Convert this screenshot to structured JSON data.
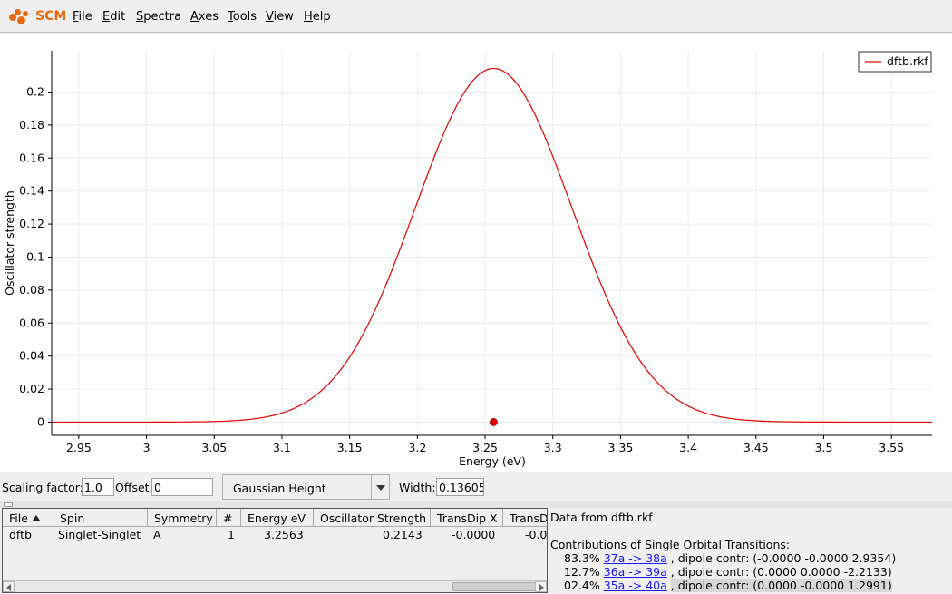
{
  "app": {
    "logo_text": "SCM",
    "menu": [
      "File",
      "Edit",
      "Spectra",
      "Axes",
      "Tools",
      "View",
      "Help"
    ],
    "menu_mnemonics": [
      "F",
      "E",
      "S",
      "A",
      "T",
      "V",
      "H"
    ]
  },
  "chart_data": {
    "type": "line",
    "xlabel": "Energy (eV)",
    "ylabel": "Oscillator strength",
    "xlim": [
      2.93,
      3.58
    ],
    "ylim": [
      -0.008,
      0.225
    ],
    "x_ticks": [
      "2.95",
      "3",
      "3.05",
      "3.1",
      "3.15",
      "3.2",
      "3.25",
      "3.3",
      "3.35",
      "3.4",
      "3.45",
      "3.5",
      "3.55"
    ],
    "x_tick_values": [
      2.95,
      3.0,
      3.05,
      3.1,
      3.15,
      3.2,
      3.25,
      3.3,
      3.35,
      3.4,
      3.45,
      3.5,
      3.55
    ],
    "y_ticks": [
      "0",
      "0.02",
      "0.04",
      "0.06",
      "0.08",
      "0.1",
      "0.12",
      "0.14",
      "0.16",
      "0.18",
      "0.2"
    ],
    "y_tick_values": [
      0,
      0.02,
      0.04,
      0.06,
      0.08,
      0.1,
      0.12,
      0.14,
      0.16,
      0.18,
      0.2
    ],
    "grid": true,
    "legend_position": "top-right",
    "series": [
      {
        "name": "dftb.rkf",
        "color": "#e00000",
        "shape": "gaussian",
        "center": 3.2563,
        "height": 0.2143,
        "width": 0.13605
      }
    ],
    "markers": [
      {
        "x": 3.2563,
        "y": 0,
        "color": "#e00000"
      }
    ]
  },
  "controls": {
    "scaling_label": "Scaling factor:",
    "scaling_value": "1.0",
    "offset_label": "Offset:",
    "offset_value": "0",
    "broadening_selected": "Gaussian Height",
    "width_label": "Width:",
    "width_value": "0.13605"
  },
  "table": {
    "columns": [
      "File",
      "Spin",
      "Symmetry",
      "#",
      "Energy eV",
      "Oscillator Strength",
      "TransDip X",
      "TransD"
    ],
    "rows": [
      [
        "dftb",
        "Singlet-Singlet",
        "A",
        "1",
        "3.2563",
        "0.2143",
        "-0.0000",
        "-0.0"
      ]
    ]
  },
  "info": {
    "source": "Data from dftb.rkf",
    "heading": "Contributions of Single Orbital Transitions:",
    "transitions": [
      {
        "percent": "83.3%",
        "link": "37a -> 38a",
        "dipole": ", dipole contr: (-0.0000 -0.0000 2.9354)"
      },
      {
        "percent": "12.7%",
        "link": "36a -> 39a",
        "dipole": ", dipole contr: (0.0000 0.0000 -2.2133)"
      },
      {
        "percent": "02.4%",
        "link": "35a -> 40a",
        "dipole": ", dipole contr: (0.0000 -0.0000 1.2991)"
      }
    ]
  },
  "colors": {
    "accent": "#e96a10",
    "series": "#e00000",
    "link": "#1a1aee"
  }
}
